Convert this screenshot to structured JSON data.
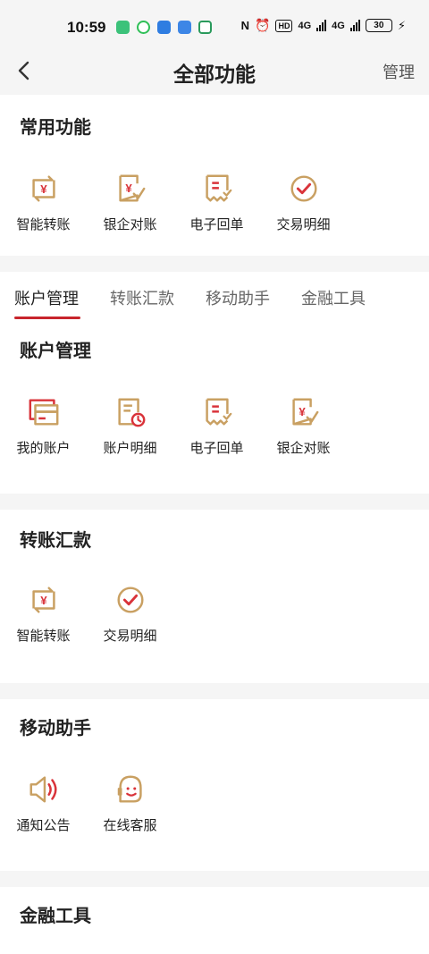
{
  "status_bar": {
    "time": "10:59",
    "signal_1": "4G",
    "signal_2": "4G",
    "hd_badge": "HD",
    "battery": "30"
  },
  "nav": {
    "title": "全部功能",
    "manage": "管理"
  },
  "common": {
    "title": "常用功能",
    "items": [
      {
        "label": "智能转账",
        "icon": "smart-transfer-icon"
      },
      {
        "label": "银企对账",
        "icon": "reconciliation-icon"
      },
      {
        "label": "电子回单",
        "icon": "e-receipt-icon"
      },
      {
        "label": "交易明细",
        "icon": "transaction-detail-icon"
      }
    ]
  },
  "tabs": [
    {
      "label": "账户管理",
      "active": true
    },
    {
      "label": "转账汇款",
      "active": false
    },
    {
      "label": "移动助手",
      "active": false
    },
    {
      "label": "金融工具",
      "active": false
    }
  ],
  "sections": {
    "account": {
      "title": "账户管理",
      "items": [
        {
          "label": "我的账户",
          "icon": "my-account-icon"
        },
        {
          "label": "账户明细",
          "icon": "account-detail-icon"
        },
        {
          "label": "电子回单",
          "icon": "e-receipt-icon"
        },
        {
          "label": "银企对账",
          "icon": "reconciliation-icon"
        }
      ]
    },
    "transfer": {
      "title": "转账汇款",
      "items": [
        {
          "label": "智能转账",
          "icon": "smart-transfer-icon"
        },
        {
          "label": "交易明细",
          "icon": "transaction-detail-icon"
        }
      ]
    },
    "assistant": {
      "title": "移动助手",
      "items": [
        {
          "label": "通知公告",
          "icon": "announcement-icon"
        },
        {
          "label": "在线客服",
          "icon": "customer-service-icon"
        }
      ]
    },
    "finance": {
      "title": "金融工具"
    }
  },
  "colors": {
    "accent_red": "#d9333a",
    "icon_gold": "#c9a062",
    "tab_underline": "#c8252c"
  }
}
